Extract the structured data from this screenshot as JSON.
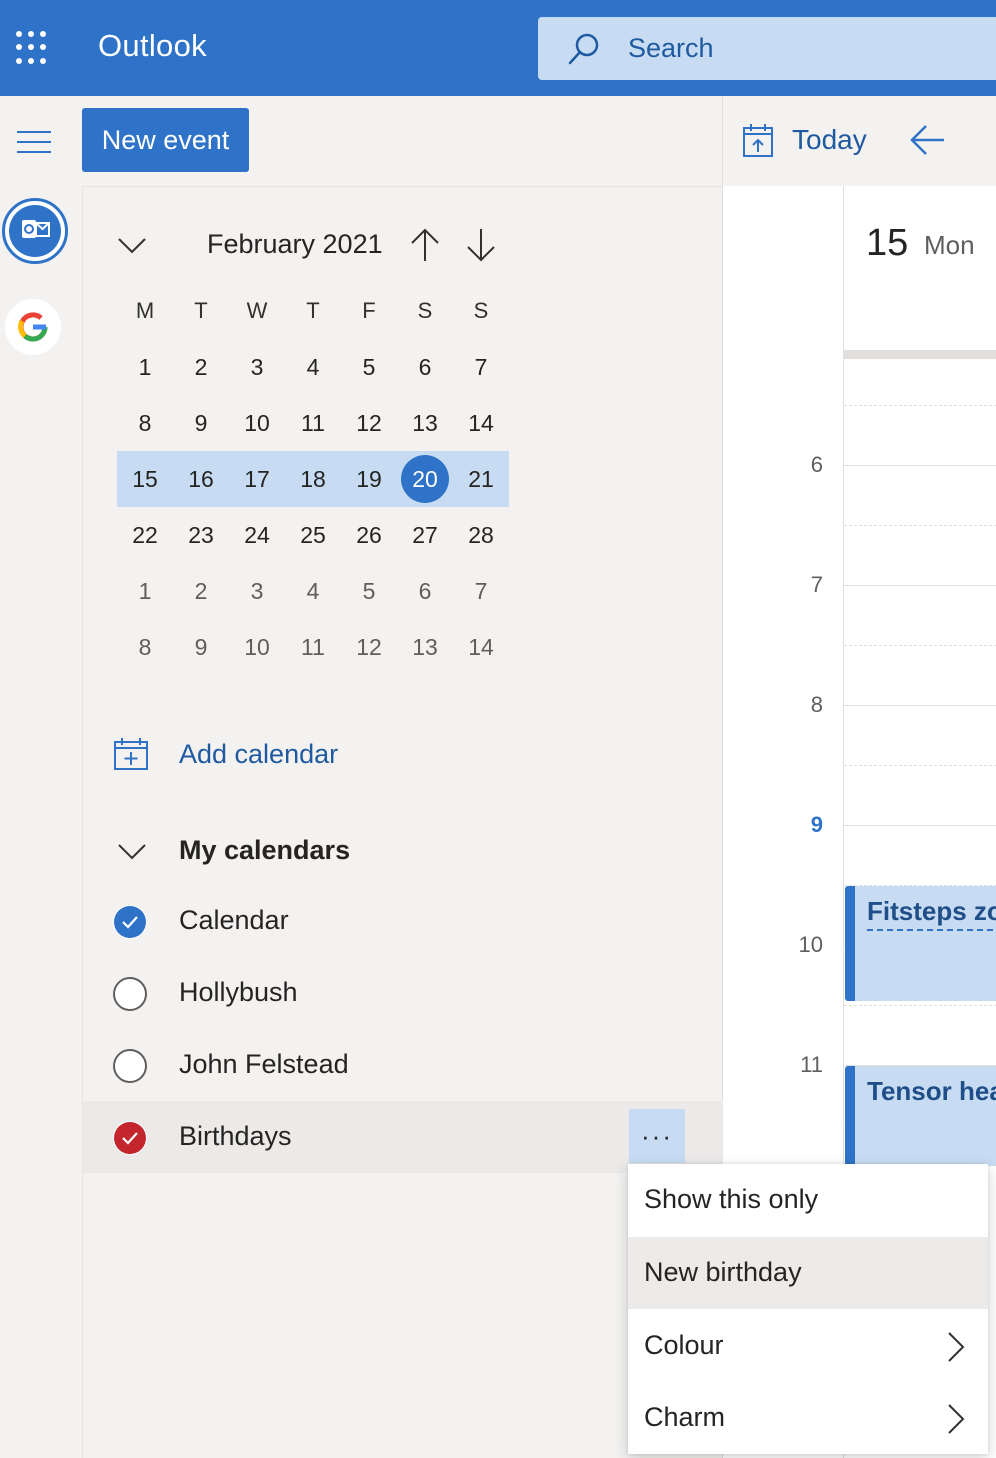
{
  "app": {
    "title": "Outlook",
    "search_placeholder": "Search"
  },
  "toolbar": {
    "new_event_label": "New event",
    "today_label": "Today"
  },
  "mini_calendar": {
    "month_label": "February 2021",
    "weekdays": [
      "M",
      "T",
      "W",
      "T",
      "F",
      "S",
      "S"
    ],
    "weeks": [
      [
        "1",
        "2",
        "3",
        "4",
        "5",
        "6",
        "7"
      ],
      [
        "8",
        "9",
        "10",
        "11",
        "12",
        "13",
        "14"
      ],
      [
        "15",
        "16",
        "17",
        "18",
        "19",
        "20",
        "21"
      ],
      [
        "22",
        "23",
        "24",
        "25",
        "26",
        "27",
        "28"
      ],
      [
        "1",
        "2",
        "3",
        "4",
        "5",
        "6",
        "7"
      ],
      [
        "8",
        "9",
        "10",
        "11",
        "12",
        "13",
        "14"
      ]
    ],
    "selected_week_index": 2,
    "today": "20"
  },
  "sidebar": {
    "add_calendar_label": "Add calendar",
    "my_calendars_label": "My calendars",
    "calendars": [
      {
        "name": "Calendar",
        "checked": true,
        "color": "#2f73c9"
      },
      {
        "name": "Hollybush",
        "checked": false,
        "color": ""
      },
      {
        "name": "John Felstead",
        "checked": false,
        "color": ""
      },
      {
        "name": "Birthdays",
        "checked": true,
        "color": "#c4262e"
      }
    ],
    "more_label": "···"
  },
  "day_view": {
    "day_number": "15",
    "day_name": "Mon",
    "hours": [
      "6",
      "7",
      "8",
      "9",
      "10",
      "11"
    ],
    "current_hour": "9",
    "events": [
      {
        "title": "Fitsteps zo"
      },
      {
        "title": "Tensor hea"
      }
    ]
  },
  "context_menu": {
    "items": [
      {
        "label": "Show this only",
        "has_submenu": false
      },
      {
        "label": "New birthday",
        "has_submenu": false
      },
      {
        "label": "Colour",
        "has_submenu": true
      },
      {
        "label": "Charm",
        "has_submenu": true
      }
    ]
  },
  "colors": {
    "brand": "#2f73c9",
    "selection": "#c7dcf3",
    "birthday": "#c4262e"
  }
}
